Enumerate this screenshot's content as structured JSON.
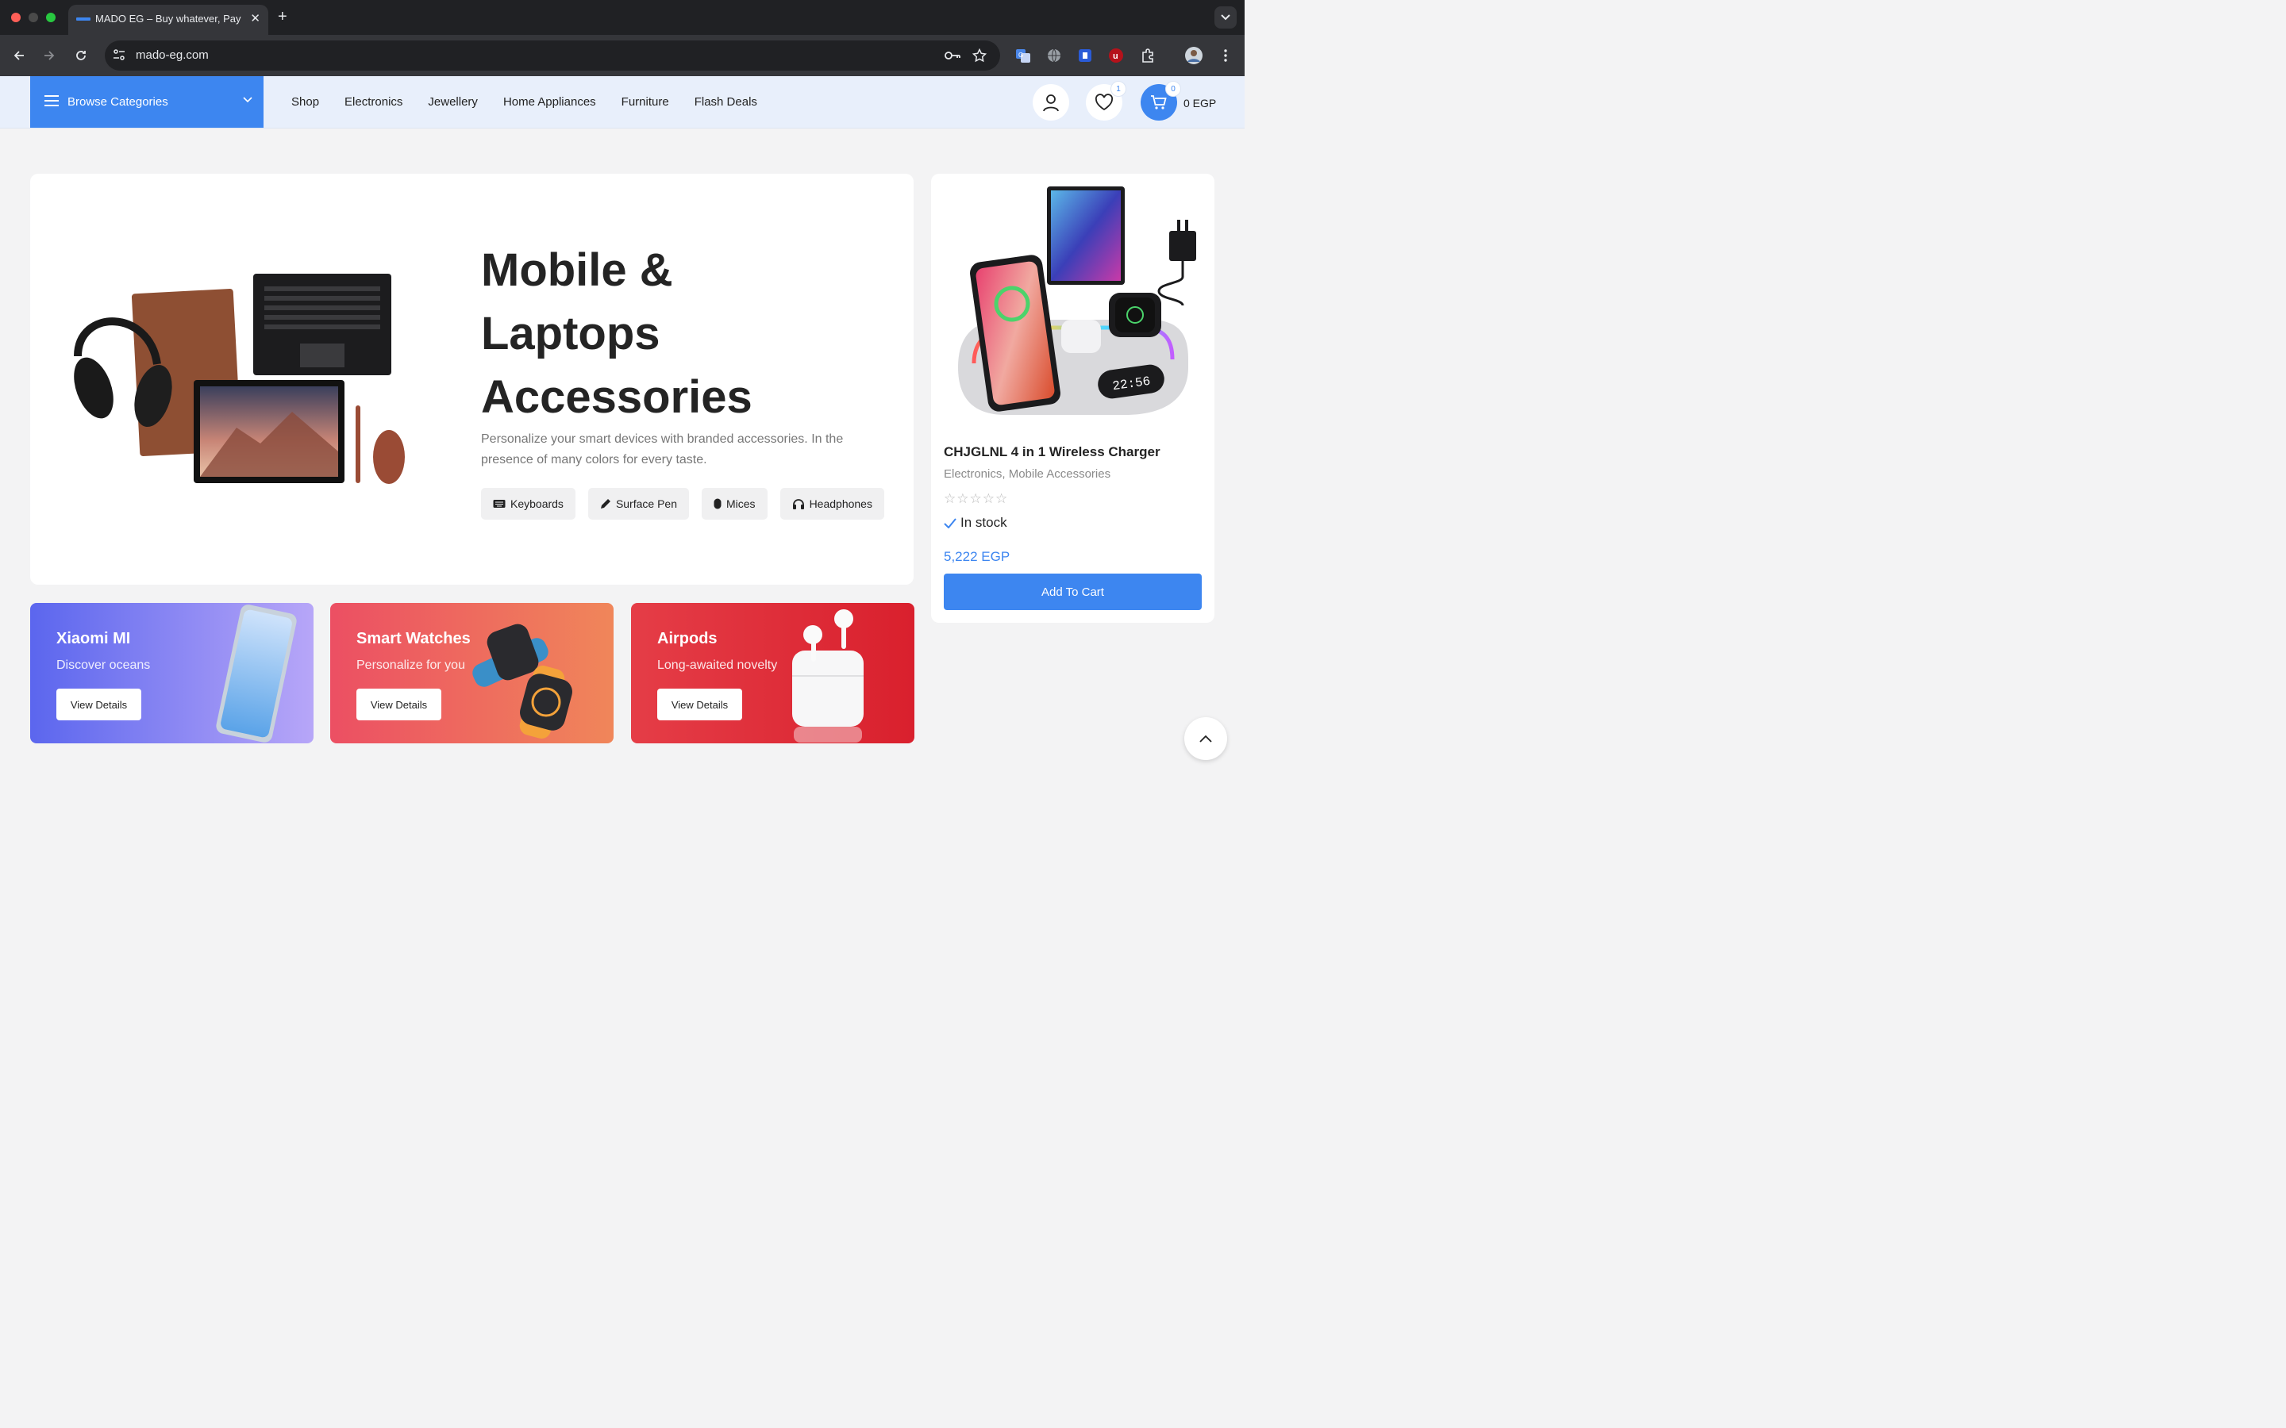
{
  "browser": {
    "tab_title": "MADO EG – Buy whatever, Pay less",
    "url": "mado-eg.com"
  },
  "header": {
    "browse_label": "Browse Categories",
    "nav": [
      "Shop",
      "Electronics",
      "Jewellery",
      "Home Appliances",
      "Furniture",
      "Flash Deals"
    ],
    "wishlist_count": "1",
    "cart_count": "0",
    "cart_total": "0 EGP"
  },
  "hero": {
    "title_lines": [
      "Mobile &",
      "Laptops",
      "Accessories"
    ],
    "description": "Personalize your smart devices with branded accessories. In the presence of many colors for every taste.",
    "chips": [
      "Keyboards",
      "Surface Pen",
      "Mices",
      "Headphones"
    ]
  },
  "product": {
    "name": "CHJGLNL 4 in 1 Wireless Charger",
    "category_1": "Electronics",
    "category_sep": ", ",
    "category_2": "Mobile Accessories",
    "stars": "☆☆☆☆☆",
    "rating": 0,
    "stock": "In stock",
    "price": "5,222 EGP",
    "button": "Add To Cart",
    "clock_text": "22:56"
  },
  "banners": [
    {
      "title": "Xiaomi MI",
      "subtitle": "Discover oceans",
      "button": "View Details"
    },
    {
      "title": "Smart Watches",
      "subtitle": "Personalize for you",
      "button": "View Details"
    },
    {
      "title": "Airpods",
      "subtitle": "Long-awaited novelty",
      "button": "View Details"
    }
  ],
  "colors": {
    "accent": "#3d86f0",
    "header_bg": "#e8effb",
    "banner_blue": "#8b7cf0",
    "banner_coral": "#f0645c",
    "banner_red": "#e2313a"
  }
}
